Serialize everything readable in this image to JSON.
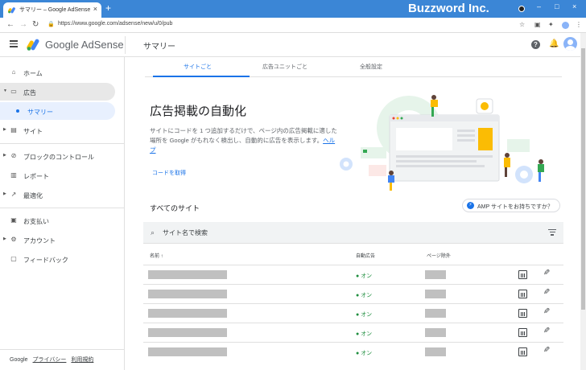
{
  "browser": {
    "tab_title": "サマリー – Google AdSense",
    "tab_close": "×",
    "new_tab": "+",
    "url": "https://www.google.com/adsense/new/u/0/pub",
    "brand_overlay": "Buzzword Inc.",
    "window_controls": [
      "–",
      "□",
      "×"
    ]
  },
  "appbar": {
    "product_name": "Google AdSense",
    "page_title": "サマリー",
    "help_glyph": "?"
  },
  "sidebar": {
    "items": [
      {
        "label": "ホーム",
        "icon": "home-icon"
      },
      {
        "label": "広告",
        "icon": "ads-icon"
      },
      {
        "label": "サマリー",
        "icon": "dot"
      },
      {
        "label": "サイト",
        "icon": "sites-icon"
      },
      {
        "label": "ブロックのコントロール",
        "icon": "block-icon"
      },
      {
        "label": "レポート",
        "icon": "report-icon"
      },
      {
        "label": "最適化",
        "icon": "optimize-icon"
      },
      {
        "label": "お支払い",
        "icon": "payments-icon"
      },
      {
        "label": "アカウント",
        "icon": "gear-icon"
      },
      {
        "label": "フィードバック",
        "icon": "feedback-icon"
      }
    ],
    "footer": {
      "brand": "Google",
      "privacy": "プライバシー",
      "terms": "利用規約"
    }
  },
  "content": {
    "tabs": [
      "サイトごと",
      "広告ユニットごと",
      "全般設定"
    ],
    "hero": {
      "title": "広告掲載の自動化",
      "description": "サイトにコードを 1 つ追加するだけで、ページ内の広告掲載に適した場所を Google がもれなく検出し、自動的に広告を表示します。",
      "help_link": "ヘルプ",
      "get_code": "コードを取得"
    },
    "sites_section_title": "すべてのサイト",
    "amp_button": "AMP サイトをお持ちですか？",
    "search_placeholder": "サイト名で検索",
    "table": {
      "headers": {
        "name": "名前 ↑",
        "auto_ads": "自動広告",
        "page_exclusion": "ページ除外"
      },
      "rows": [
        {
          "status": "オン"
        },
        {
          "status": "オン"
        },
        {
          "status": "オン"
        },
        {
          "status": "オン"
        },
        {
          "status": "オン"
        }
      ]
    }
  },
  "colors": {
    "accent": "#1a73e8",
    "status_on": "#1e8e3e",
    "window_frame": "#3b86d6"
  }
}
